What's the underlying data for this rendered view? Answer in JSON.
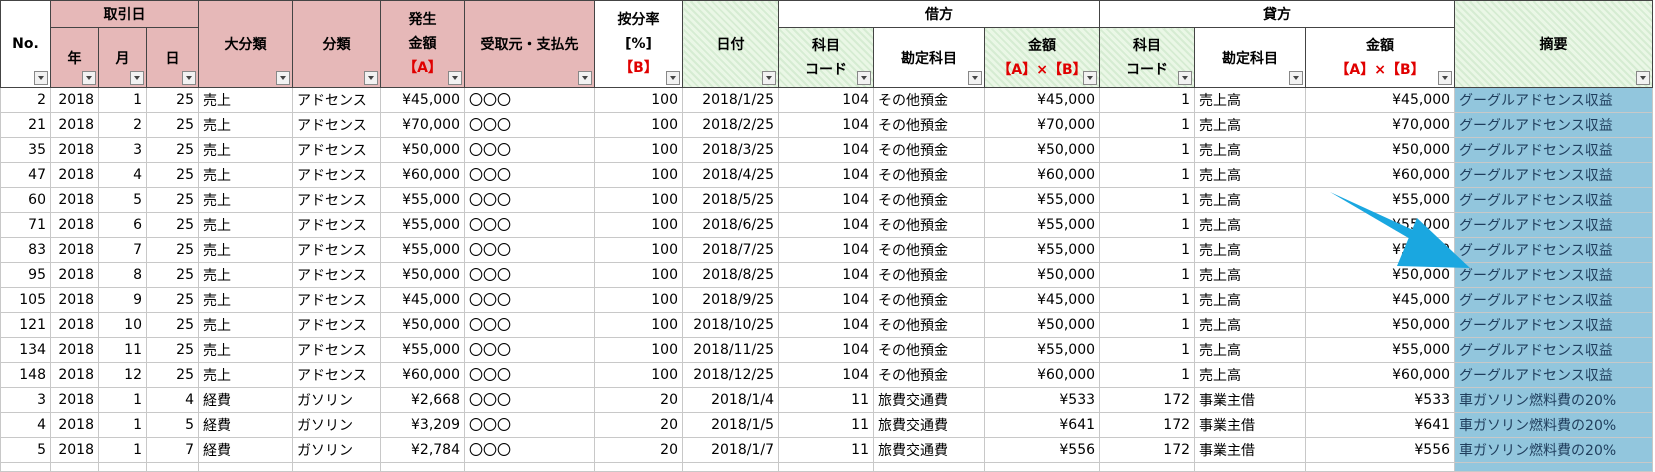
{
  "headers": {
    "no": "No.",
    "torihikibi": "取引日",
    "year": "年",
    "month": "月",
    "day": "日",
    "daibunrui": "大分類",
    "bunrui": "分類",
    "hassei_l1": "発生",
    "hassei_l2": "金額",
    "hassei_l3": "【A】",
    "partner": "受取元・支払先",
    "ratio_l1": "按分率",
    "ratio_l2": "[%]",
    "ratio_l3": "【B】",
    "date": "日付",
    "karikata": "借方",
    "kamoku_l1": "科目",
    "kamoku_l2": "コード",
    "kanjo": "勘定科目",
    "kingaku_l1": "金額",
    "kingaku_l2": "【A】×【B】",
    "kashikata": "貸方",
    "tekiyo": "摘要"
  },
  "rows": [
    {
      "no": "2",
      "year": "2018",
      "month": "1",
      "day": "25",
      "daibunrui": "売上",
      "bunrui": "アドセンス",
      "amount": "¥45,000",
      "partner": "〇〇〇",
      "ratio": "100",
      "date": "2018/1/25",
      "dcode": "104",
      "dacct": "その他預金",
      "damt": "¥45,000",
      "ccode": "1",
      "cacct": "売上高",
      "camt": "¥45,000",
      "memo": "グーグルアドセンス収益"
    },
    {
      "no": "21",
      "year": "2018",
      "month": "2",
      "day": "25",
      "daibunrui": "売上",
      "bunrui": "アドセンス",
      "amount": "¥70,000",
      "partner": "〇〇〇",
      "ratio": "100",
      "date": "2018/2/25",
      "dcode": "104",
      "dacct": "その他預金",
      "damt": "¥70,000",
      "ccode": "1",
      "cacct": "売上高",
      "camt": "¥70,000",
      "memo": "グーグルアドセンス収益"
    },
    {
      "no": "35",
      "year": "2018",
      "month": "3",
      "day": "25",
      "daibunrui": "売上",
      "bunrui": "アドセンス",
      "amount": "¥50,000",
      "partner": "〇〇〇",
      "ratio": "100",
      "date": "2018/3/25",
      "dcode": "104",
      "dacct": "その他預金",
      "damt": "¥50,000",
      "ccode": "1",
      "cacct": "売上高",
      "camt": "¥50,000",
      "memo": "グーグルアドセンス収益"
    },
    {
      "no": "47",
      "year": "2018",
      "month": "4",
      "day": "25",
      "daibunrui": "売上",
      "bunrui": "アドセンス",
      "amount": "¥60,000",
      "partner": "〇〇〇",
      "ratio": "100",
      "date": "2018/4/25",
      "dcode": "104",
      "dacct": "その他預金",
      "damt": "¥60,000",
      "ccode": "1",
      "cacct": "売上高",
      "camt": "¥60,000",
      "memo": "グーグルアドセンス収益"
    },
    {
      "no": "60",
      "year": "2018",
      "month": "5",
      "day": "25",
      "daibunrui": "売上",
      "bunrui": "アドセンス",
      "amount": "¥55,000",
      "partner": "〇〇〇",
      "ratio": "100",
      "date": "2018/5/25",
      "dcode": "104",
      "dacct": "その他預金",
      "damt": "¥55,000",
      "ccode": "1",
      "cacct": "売上高",
      "camt": "¥55,000",
      "memo": "グーグルアドセンス収益"
    },
    {
      "no": "71",
      "year": "2018",
      "month": "6",
      "day": "25",
      "daibunrui": "売上",
      "bunrui": "アドセンス",
      "amount": "¥55,000",
      "partner": "〇〇〇",
      "ratio": "100",
      "date": "2018/6/25",
      "dcode": "104",
      "dacct": "その他預金",
      "damt": "¥55,000",
      "ccode": "1",
      "cacct": "売上高",
      "camt": "¥55,000",
      "memo": "グーグルアドセンス収益"
    },
    {
      "no": "83",
      "year": "2018",
      "month": "7",
      "day": "25",
      "daibunrui": "売上",
      "bunrui": "アドセンス",
      "amount": "¥55,000",
      "partner": "〇〇〇",
      "ratio": "100",
      "date": "2018/7/25",
      "dcode": "104",
      "dacct": "その他預金",
      "damt": "¥55,000",
      "ccode": "1",
      "cacct": "売上高",
      "camt": "¥55,000",
      "memo": "グーグルアドセンス収益"
    },
    {
      "no": "95",
      "year": "2018",
      "month": "8",
      "day": "25",
      "daibunrui": "売上",
      "bunrui": "アドセンス",
      "amount": "¥50,000",
      "partner": "〇〇〇",
      "ratio": "100",
      "date": "2018/8/25",
      "dcode": "104",
      "dacct": "その他預金",
      "damt": "¥50,000",
      "ccode": "1",
      "cacct": "売上高",
      "camt": "¥50,000",
      "memo": "グーグルアドセンス収益"
    },
    {
      "no": "105",
      "year": "2018",
      "month": "9",
      "day": "25",
      "daibunrui": "売上",
      "bunrui": "アドセンス",
      "amount": "¥45,000",
      "partner": "〇〇〇",
      "ratio": "100",
      "date": "2018/9/25",
      "dcode": "104",
      "dacct": "その他預金",
      "damt": "¥45,000",
      "ccode": "1",
      "cacct": "売上高",
      "camt": "¥45,000",
      "memo": "グーグルアドセンス収益"
    },
    {
      "no": "121",
      "year": "2018",
      "month": "10",
      "day": "25",
      "daibunrui": "売上",
      "bunrui": "アドセンス",
      "amount": "¥50,000",
      "partner": "〇〇〇",
      "ratio": "100",
      "date": "2018/10/25",
      "dcode": "104",
      "dacct": "その他預金",
      "damt": "¥50,000",
      "ccode": "1",
      "cacct": "売上高",
      "camt": "¥50,000",
      "memo": "グーグルアドセンス収益"
    },
    {
      "no": "134",
      "year": "2018",
      "month": "11",
      "day": "25",
      "daibunrui": "売上",
      "bunrui": "アドセンス",
      "amount": "¥55,000",
      "partner": "〇〇〇",
      "ratio": "100",
      "date": "2018/11/25",
      "dcode": "104",
      "dacct": "その他預金",
      "damt": "¥55,000",
      "ccode": "1",
      "cacct": "売上高",
      "camt": "¥55,000",
      "memo": "グーグルアドセンス収益"
    },
    {
      "no": "148",
      "year": "2018",
      "month": "12",
      "day": "25",
      "daibunrui": "売上",
      "bunrui": "アドセンス",
      "amount": "¥60,000",
      "partner": "〇〇〇",
      "ratio": "100",
      "date": "2018/12/25",
      "dcode": "104",
      "dacct": "その他預金",
      "damt": "¥60,000",
      "ccode": "1",
      "cacct": "売上高",
      "camt": "¥60,000",
      "memo": "グーグルアドセンス収益"
    },
    {
      "no": "3",
      "year": "2018",
      "month": "1",
      "day": "4",
      "daibunrui": "経費",
      "bunrui": "ガソリン",
      "amount": "¥2,668",
      "partner": "〇〇〇",
      "ratio": "20",
      "date": "2018/1/4",
      "dcode": "11",
      "dacct": "旅費交通費",
      "damt": "¥533",
      "ccode": "172",
      "cacct": "事業主借",
      "camt": "¥533",
      "memo": "車ガソリン燃料費の20%"
    },
    {
      "no": "4",
      "year": "2018",
      "month": "1",
      "day": "5",
      "daibunrui": "経費",
      "bunrui": "ガソリン",
      "amount": "¥3,209",
      "partner": "〇〇〇",
      "ratio": "20",
      "date": "2018/1/5",
      "dcode": "11",
      "dacct": "旅費交通費",
      "damt": "¥641",
      "ccode": "172",
      "cacct": "事業主借",
      "camt": "¥641",
      "memo": "車ガソリン燃料費の20%"
    },
    {
      "no": "5",
      "year": "2018",
      "month": "1",
      "day": "7",
      "daibunrui": "経費",
      "bunrui": "ガソリン",
      "amount": "¥2,784",
      "partner": "〇〇〇",
      "ratio": "20",
      "date": "2018/1/7",
      "dcode": "11",
      "dacct": "旅費交通費",
      "damt": "¥556",
      "ccode": "172",
      "cacct": "事業主借",
      "camt": "¥556",
      "memo": "車ガソリン燃料費の20%"
    }
  ],
  "colors": {
    "header_pink": "#e6b8b8",
    "header_green": "#eaf7e6",
    "memo_highlight": "#92c6dd",
    "arrow": "#1aa7e0",
    "red_text": "#e00000"
  },
  "annotation": {
    "icon": "arrow-pointing-to-memo-column"
  }
}
